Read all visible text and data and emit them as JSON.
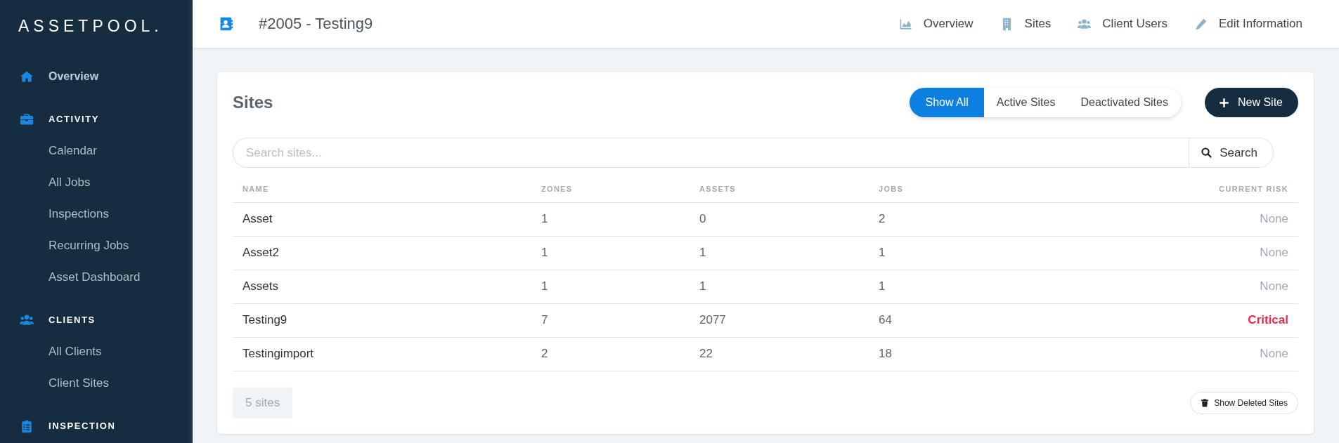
{
  "sidebar": {
    "logo": "ASSETPOOL.",
    "items": [
      {
        "kind": "link",
        "label": "Overview",
        "selected": true
      },
      {
        "kind": "section",
        "label": "ACTIVITY"
      },
      {
        "kind": "sub",
        "label": "Calendar",
        "selected": false
      },
      {
        "kind": "sub",
        "label": "All Jobs",
        "selected": false
      },
      {
        "kind": "sub",
        "label": "Inspections",
        "selected": false
      },
      {
        "kind": "sub",
        "label": "Recurring Jobs",
        "selected": false
      },
      {
        "kind": "sub",
        "label": "Asset Dashboard",
        "selected": false
      },
      {
        "kind": "section",
        "label": "CLIENTS"
      },
      {
        "kind": "sub",
        "label": "All Clients",
        "selected": false
      },
      {
        "kind": "sub",
        "label": "Client Sites",
        "selected": false
      },
      {
        "kind": "section",
        "label": "INSPECTION"
      }
    ]
  },
  "header": {
    "title": "#2005 - Testing9",
    "nav": [
      {
        "label": "Overview"
      },
      {
        "label": "Sites"
      },
      {
        "label": "Client Users"
      },
      {
        "label": "Edit Information"
      }
    ]
  },
  "sites_card": {
    "title": "Sites",
    "filters": [
      {
        "label": "Show All",
        "selected": true
      },
      {
        "label": "Active Sites",
        "selected": false
      },
      {
        "label": "Deactivated Sites",
        "selected": false
      }
    ],
    "new_button": "New Site",
    "search": {
      "placeholder": "Search sites...",
      "button": "Search"
    },
    "table": {
      "columns": [
        "NAME",
        "ZONES",
        "ASSETS",
        "JOBS",
        "CURRENT RISK"
      ],
      "rows": [
        {
          "name": "Asset",
          "zones": "1",
          "assets": "0",
          "jobs": "2",
          "risk": "None",
          "critical": false
        },
        {
          "name": "Asset2",
          "zones": "1",
          "assets": "1",
          "jobs": "1",
          "risk": "None",
          "critical": false
        },
        {
          "name": "Assets",
          "zones": "1",
          "assets": "1",
          "jobs": "1",
          "risk": "None",
          "critical": false
        },
        {
          "name": "Testing9",
          "zones": "7",
          "assets": "2077",
          "jobs": "64",
          "risk": "Critical",
          "critical": true
        },
        {
          "name": "Testingimport",
          "zones": "2",
          "assets": "22",
          "jobs": "18",
          "risk": "None",
          "critical": false
        }
      ]
    },
    "count": "5 sites",
    "deleted_button": "Show Deleted Sites"
  }
}
